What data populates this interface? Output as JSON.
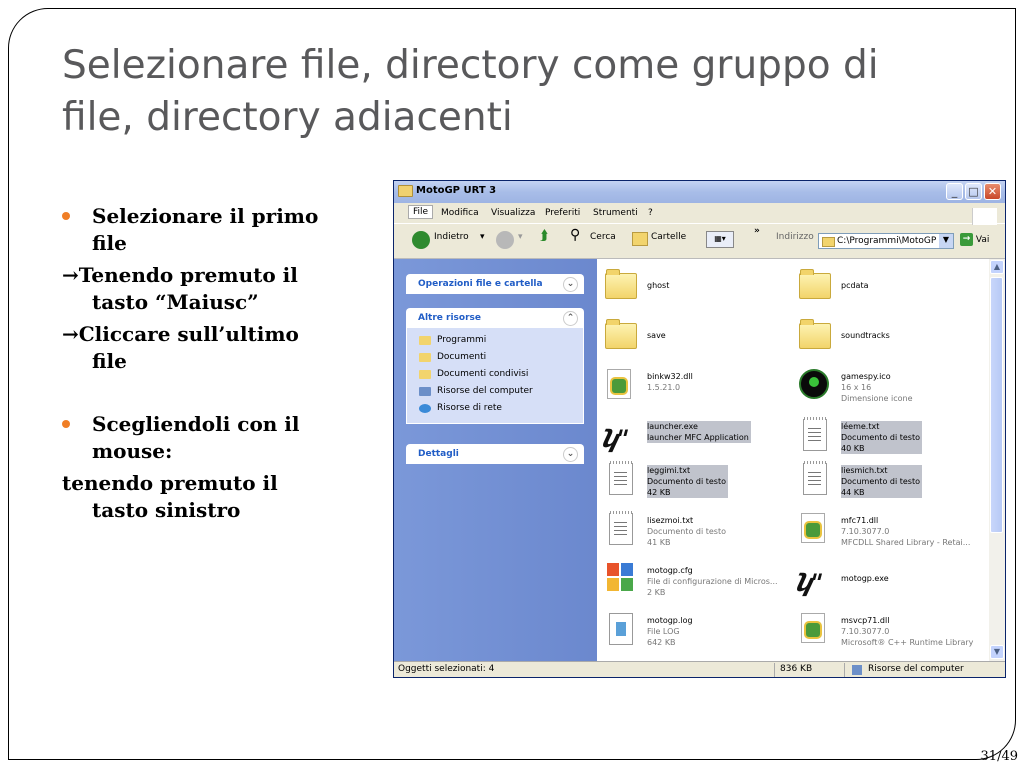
{
  "slide": {
    "title_line1": "Selezionare file, directory come gruppo di",
    "title_line2": "file, directory adiacenti",
    "b1_line1": "Selezionare il primo",
    "b1_line2": "file",
    "b2_line1": "→Tenendo premuto il",
    "b2_line2": "tasto “Maiusc”",
    "b3_line1": "→Cliccare sull’ultimo",
    "b3_line2": "file",
    "b4_line1": "Scegliendoli con il",
    "b4_line2": "mouse:",
    "b5_line1": "tenendo premuto il",
    "b5_line2": "tasto sinistro",
    "page_number": "31/49",
    "bullet_color": "#f07e26"
  },
  "window": {
    "title": "MotoGP URT 3",
    "menu": [
      "File",
      "Modifica",
      "Visualizza",
      "Preferiti",
      "Strumenti",
      "?"
    ],
    "toolbar": {
      "back": "Indietro",
      "search": "Cerca",
      "folders": "Cartelle",
      "address_label": "Indirizzo",
      "address_value": "C:\\Programmi\\MotoGP U",
      "go": "Vai"
    },
    "tasks": {
      "file_ops": "Operazioni file e cartella",
      "other": "Altre risorse",
      "other_items": [
        "Programmi",
        "Documenti",
        "Documenti condivisi",
        "Risorse del computer",
        "Risorse di rete"
      ],
      "details": "Dettagli"
    },
    "files": [
      {
        "name": "ghost",
        "l2": "",
        "l3": ""
      },
      {
        "name": "pcdata",
        "l2": "",
        "l3": ""
      },
      {
        "name": "save",
        "l2": "",
        "l3": ""
      },
      {
        "name": "soundtracks",
        "l2": "",
        "l3": ""
      },
      {
        "name": "binkw32.dll",
        "l2": "1.5.21.0",
        "l3": ""
      },
      {
        "name": "gamespy.ico",
        "l2": "16 x 16",
        "l3": "Dimensione icone"
      },
      {
        "name": "launcher.exe",
        "l2": "launcher MFC Application",
        "l3": ""
      },
      {
        "name": "léeme.txt",
        "l2": "Documento di testo",
        "l3": "40 KB"
      },
      {
        "name": "leggimi.txt",
        "l2": "Documento di testo",
        "l3": "42 KB"
      },
      {
        "name": "liesmich.txt",
        "l2": "Documento di testo",
        "l3": "44 KB"
      },
      {
        "name": "lisezmoi.txt",
        "l2": "Documento di testo",
        "l3": "41 KB"
      },
      {
        "name": "mfc71.dll",
        "l2": "7.10.3077.0",
        "l3": "MFCDLL Shared Library - Retai..."
      },
      {
        "name": "motogp.cfg",
        "l2": "File di configurazione di Micros...",
        "l3": "2 KB"
      },
      {
        "name": "motogp.exe",
        "l2": "",
        "l3": ""
      },
      {
        "name": "motogp.log",
        "l2": "File LOG",
        "l3": "642 KB"
      },
      {
        "name": "msvcp71.dll",
        "l2": "7.10.3077.0",
        "l3": "Microsoft® C++ Runtime Library"
      }
    ],
    "status": {
      "selected": "Oggetti selezionati: 4",
      "size": "836 KB",
      "location": "Risorse del computer"
    }
  }
}
